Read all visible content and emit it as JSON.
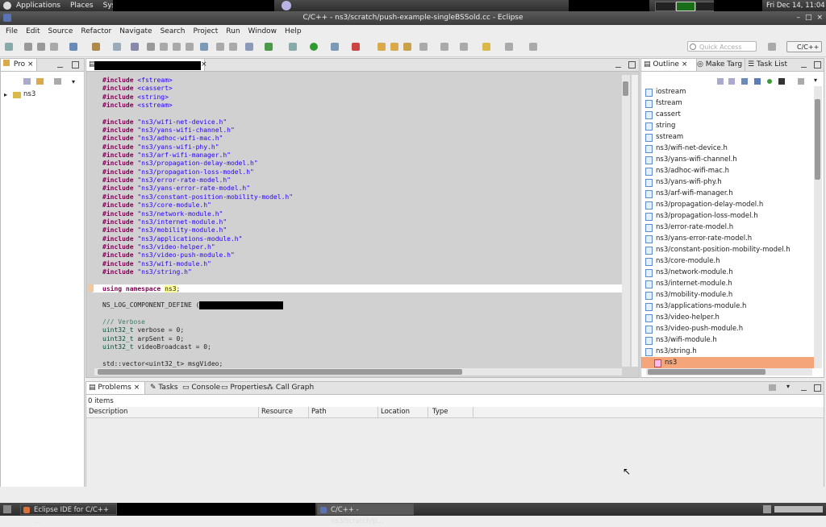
{
  "top_panel": {
    "menus": [
      "Applications",
      "Places",
      "System"
    ],
    "clock": "Fri Dec 14, 11:04"
  },
  "window": {
    "title": "C/C++ - ns3/scratch/push-example-singleBSSold.cc - Eclipse"
  },
  "menu_bar": [
    "File",
    "Edit",
    "Source",
    "Refactor",
    "Navigate",
    "Search",
    "Project",
    "Run",
    "Window",
    "Help"
  ],
  "toolbar": {
    "quick_access_placeholder": "Quick Access",
    "perspective": "C/C++"
  },
  "project_explorer": {
    "tab": "Pro",
    "items": [
      {
        "label": "ns3"
      }
    ]
  },
  "editor": {
    "code_lines": [
      {
        "t": "inc",
        "h": "<fstream>"
      },
      {
        "t": "inc",
        "h": "<cassert>"
      },
      {
        "t": "inc",
        "h": "<string>"
      },
      {
        "t": "inc",
        "h": "<sstream>"
      },
      {
        "t": "blank"
      },
      {
        "t": "inc",
        "h": "\"ns3/wifi-net-device.h\""
      },
      {
        "t": "inc",
        "h": "\"ns3/yans-wifi-channel.h\""
      },
      {
        "t": "inc",
        "h": "\"ns3/adhoc-wifi-mac.h\""
      },
      {
        "t": "inc",
        "h": "\"ns3/yans-wifi-phy.h\""
      },
      {
        "t": "inc",
        "h": "\"ns3/arf-wifi-manager.h\""
      },
      {
        "t": "inc",
        "h": "\"ns3/propagation-delay-model.h\""
      },
      {
        "t": "inc",
        "h": "\"ns3/propagation-loss-model.h\""
      },
      {
        "t": "inc",
        "h": "\"ns3/error-rate-model.h\""
      },
      {
        "t": "inc",
        "h": "\"ns3/yans-error-rate-model.h\""
      },
      {
        "t": "inc",
        "h": "\"ns3/constant-position-mobility-model.h\""
      },
      {
        "t": "inc",
        "h": "\"ns3/core-module.h\""
      },
      {
        "t": "inc",
        "h": "\"ns3/network-module.h\""
      },
      {
        "t": "inc",
        "h": "\"ns3/internet-module.h\""
      },
      {
        "t": "inc",
        "h": "\"ns3/mobility-module.h\""
      },
      {
        "t": "inc",
        "h": "\"ns3/applications-module.h\""
      },
      {
        "t": "inc",
        "h": "\"ns3/video-helper.h\""
      },
      {
        "t": "inc",
        "h": "\"ns3/video-push-module.h\""
      },
      {
        "t": "inc",
        "h": "\"ns3/wifi-module.h\""
      },
      {
        "t": "inc",
        "h": "\"ns3/string.h\""
      },
      {
        "t": "blank"
      },
      {
        "t": "using",
        "ns": "ns3"
      },
      {
        "t": "blank"
      },
      {
        "t": "plain",
        "text": "NS_LOG_COMPONENT_DEFINE ("
      },
      {
        "t": "blank"
      },
      {
        "t": "comment",
        "text": "/// Verbose"
      },
      {
        "t": "decl",
        "ty": "uint32_t",
        "rest": " verbose = 0;"
      },
      {
        "t": "decl",
        "ty": "uint32_t",
        "rest": " arpSent = 0;"
      },
      {
        "t": "decl",
        "ty": "uint32_t",
        "rest": " videoBroadcast = 0;"
      },
      {
        "t": "blank"
      },
      {
        "t": "plain",
        "text": "std::vector<uint32_t> msgVideo;"
      }
    ]
  },
  "outline": {
    "tabs": [
      "Outline",
      "Make Targ",
      "Task List"
    ],
    "items": [
      "iostream",
      "fstream",
      "cassert",
      "string",
      "sstream",
      "ns3/wifi-net-device.h",
      "ns3/yans-wifi-channel.h",
      "ns3/adhoc-wifi-mac.h",
      "ns3/yans-wifi-phy.h",
      "ns3/arf-wifi-manager.h",
      "ns3/propagation-delay-model.h",
      "ns3/propagation-loss-model.h",
      "ns3/error-rate-model.h",
      "ns3/yans-error-rate-model.h",
      "ns3/constant-position-mobility-model.h",
      "ns3/core-module.h",
      "ns3/network-module.h",
      "ns3/internet-module.h",
      "ns3/mobility-module.h",
      "ns3/applications-module.h",
      "ns3/video-helper.h",
      "ns3/video-push-module.h",
      "ns3/wifi-module.h",
      "ns3/string.h",
      "ns3"
    ],
    "selected_index": 24
  },
  "problems": {
    "tabs": [
      "Problems",
      "Tasks",
      "Console",
      "Properties",
      "Call Graph"
    ],
    "count_label": "0 items",
    "columns": [
      "Description",
      "Resource",
      "Path",
      "Location",
      "Type"
    ]
  },
  "taskbar": {
    "tasks": [
      "Eclipse IDE for C/C++ ...",
      "C/C++ - ns3/scratch/p..."
    ]
  },
  "colors": {
    "keyword": "#7f0055",
    "string": "#2a00ff",
    "comment": "#3f7f5f",
    "selection": "#f4a57a"
  }
}
